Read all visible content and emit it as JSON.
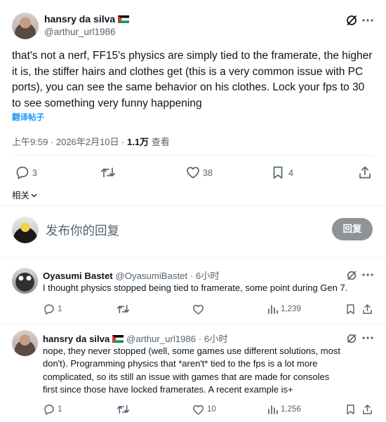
{
  "main_post": {
    "display_name": "hansry da silva",
    "handle": "@arthur_url1986",
    "text": "that's not a nerf, FF15's physics are simply tied to the framerate, the higher it is, the stiffer hairs and clothes get (this is a very common issue with PC ports), you can see the same behavior on his clothes. Lock your fps to 30 to see something very funny happening",
    "translate_label": "翻译帖子",
    "time": "上午9:59 · 2026年2月10日 · ",
    "views_count": "1.1万",
    "views_label": " 查看",
    "replies": "3",
    "likes": "38",
    "bookmarks": "4",
    "related_label": "相关"
  },
  "compose": {
    "placeholder": "发布你的回复",
    "button_label": "回复"
  },
  "replies": [
    {
      "display_name": "Oyasumi Bastet",
      "handle": "@OyasumiBastet",
      "time": "· 6小时",
      "text": "I thought physics stopped being tied to framerate, some point during Gen 7.",
      "replies": "1",
      "likes": "",
      "views": "1,239"
    },
    {
      "display_name": "hansry da silva",
      "handle": "@arthur_url1986",
      "time": "· 6小时",
      "text_lines": [
        "nope, they never stopped (well, some games use different solutions, most",
        "don't). Programming physics that *aren't* tied to the fps is a lot more",
        "complicated, so its still an issue with games that are made for consoles",
        "first since those have locked framerates. A recent example is+"
      ],
      "replies": "1",
      "likes": "10",
      "views": "1,256"
    }
  ],
  "colors": {
    "text": "#0f1419",
    "muted": "#536471",
    "link": "#1d9bf0",
    "divider": "#eff3f4",
    "reply_button": "#8f9398"
  }
}
